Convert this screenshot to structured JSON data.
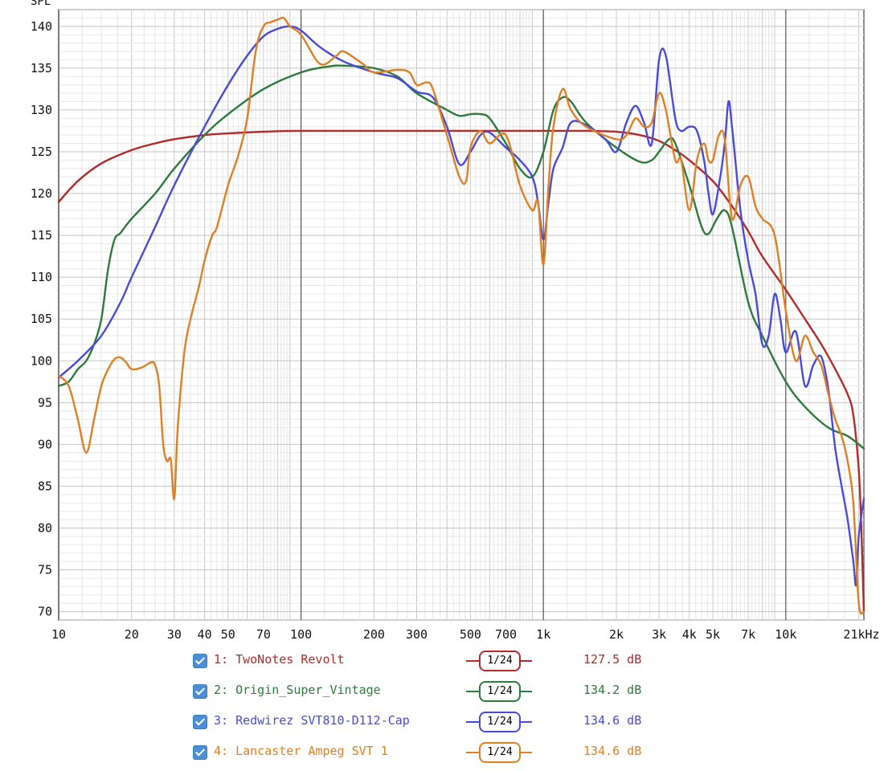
{
  "chart_data": {
    "type": "line",
    "title": "",
    "ylabel": "SPL",
    "xlabel": "",
    "xscale": "log",
    "xlim": [
      10,
      21000
    ],
    "ylim": [
      69,
      142
    ],
    "grid": true,
    "x_ticks": [
      10,
      20,
      30,
      40,
      50,
      70,
      100,
      200,
      300,
      500,
      700,
      1000,
      2000,
      3000,
      4000,
      5000,
      7000,
      10000,
      21000
    ],
    "x_tick_labels": [
      "10",
      "20",
      "30",
      "40",
      "50",
      "70",
      "100",
      "200",
      "300",
      "500",
      "700",
      "1k",
      "2k",
      "3k",
      "4k",
      "5k",
      "7k",
      "10k",
      "21kHz"
    ],
    "y_ticks": [
      70,
      75,
      80,
      85,
      90,
      95,
      100,
      105,
      110,
      115,
      120,
      125,
      130,
      135,
      140
    ],
    "y_tick_labels": [
      "70",
      "75",
      "80",
      "85",
      "90",
      "95",
      "100",
      "105",
      "110",
      "115",
      "120",
      "125",
      "130",
      "135",
      "140"
    ],
    "series": [
      {
        "name": "1: TwoNotes Revolt",
        "color": "#b22a2a",
        "smoothing": "1/24",
        "level": "127.5 dB",
        "points": [
          [
            10,
            119
          ],
          [
            12,
            121.5
          ],
          [
            15,
            123.6
          ],
          [
            20,
            125.2
          ],
          [
            25,
            126
          ],
          [
            30,
            126.5
          ],
          [
            40,
            127
          ],
          [
            50,
            127.2
          ],
          [
            70,
            127.4
          ],
          [
            100,
            127.5
          ],
          [
            300,
            127.5
          ],
          [
            1000,
            127.5
          ],
          [
            1500,
            127.5
          ],
          [
            2000,
            127.4
          ],
          [
            2500,
            127
          ],
          [
            3000,
            126.3
          ],
          [
            3500,
            125.2
          ],
          [
            4000,
            124
          ],
          [
            5000,
            121.5
          ],
          [
            6000,
            118.5
          ],
          [
            7000,
            115.5
          ],
          [
            8000,
            112.5
          ],
          [
            10000,
            108.5
          ],
          [
            12000,
            105
          ],
          [
            14000,
            102
          ],
          [
            16000,
            99
          ],
          [
            18000,
            96
          ],
          [
            19000,
            93.5
          ],
          [
            20000,
            87
          ],
          [
            20500,
            80
          ],
          [
            21000,
            70
          ]
        ]
      },
      {
        "name": "2: Origin_Super_Vintage",
        "color": "#2e7a3e",
        "smoothing": "1/24",
        "level": "134.2 dB",
        "points": [
          [
            10,
            97
          ],
          [
            11,
            97.5
          ],
          [
            12,
            99
          ],
          [
            13,
            100
          ],
          [
            14,
            102
          ],
          [
            15,
            105
          ],
          [
            16,
            111
          ],
          [
            17,
            114.5
          ],
          [
            18,
            115.3
          ],
          [
            20,
            117
          ],
          [
            25,
            120
          ],
          [
            30,
            123
          ],
          [
            40,
            127
          ],
          [
            50,
            129.5
          ],
          [
            70,
            132.5
          ],
          [
            100,
            134.5
          ],
          [
            130,
            135.2
          ],
          [
            150,
            135.3
          ],
          [
            200,
            135
          ],
          [
            250,
            134
          ],
          [
            300,
            132
          ],
          [
            400,
            130
          ],
          [
            450,
            129.3
          ],
          [
            500,
            129.5
          ],
          [
            550,
            129.5
          ],
          [
            600,
            129
          ],
          [
            700,
            126
          ],
          [
            800,
            123
          ],
          [
            900,
            122
          ],
          [
            1000,
            125
          ],
          [
            1100,
            130
          ],
          [
            1200,
            131.5
          ],
          [
            1300,
            131
          ],
          [
            1500,
            128.5
          ],
          [
            2000,
            125.5
          ],
          [
            2500,
            123.8
          ],
          [
            2800,
            124
          ],
          [
            3000,
            125
          ],
          [
            3300,
            126.5
          ],
          [
            3500,
            126
          ],
          [
            4000,
            121
          ],
          [
            4500,
            116
          ],
          [
            4800,
            115.2
          ],
          [
            5200,
            117
          ],
          [
            5600,
            118
          ],
          [
            6000,
            116
          ],
          [
            7000,
            107
          ],
          [
            8000,
            103
          ],
          [
            10000,
            97.5
          ],
          [
            12000,
            94.5
          ],
          [
            15000,
            92
          ],
          [
            18000,
            91
          ],
          [
            21000,
            89.5
          ]
        ]
      },
      {
        "name": "3: Redwirez SVT810-D112-Cap",
        "color": "#4a4ad9",
        "smoothing": "1/24",
        "level": "134.6 dB",
        "points": [
          [
            10,
            98
          ],
          [
            12,
            100
          ],
          [
            15,
            103
          ],
          [
            18,
            107
          ],
          [
            20,
            110
          ],
          [
            25,
            116
          ],
          [
            30,
            121
          ],
          [
            40,
            128
          ],
          [
            50,
            133
          ],
          [
            60,
            136.5
          ],
          [
            70,
            138.8
          ],
          [
            80,
            139.7
          ],
          [
            90,
            140
          ],
          [
            100,
            139.5
          ],
          [
            120,
            137.5
          ],
          [
            150,
            135.8
          ],
          [
            200,
            134.5
          ],
          [
            250,
            133.8
          ],
          [
            300,
            132.2
          ],
          [
            350,
            131.5
          ],
          [
            400,
            128
          ],
          [
            450,
            123.5
          ],
          [
            500,
            125
          ],
          [
            550,
            127
          ],
          [
            600,
            127.3
          ],
          [
            700,
            125.5
          ],
          [
            800,
            124
          ],
          [
            900,
            122
          ],
          [
            950,
            119
          ],
          [
            1000,
            114.5
          ],
          [
            1050,
            119
          ],
          [
            1100,
            123
          ],
          [
            1200,
            125.5
          ],
          [
            1300,
            128.5
          ],
          [
            1500,
            128.2
          ],
          [
            1800,
            126.5
          ],
          [
            2000,
            125
          ],
          [
            2200,
            128.5
          ],
          [
            2400,
            130.5
          ],
          [
            2600,
            128.5
          ],
          [
            2800,
            126
          ],
          [
            3000,
            136
          ],
          [
            3200,
            136.5
          ],
          [
            3500,
            129
          ],
          [
            3700,
            127.5
          ],
          [
            4000,
            128
          ],
          [
            4300,
            127.5
          ],
          [
            4600,
            124
          ],
          [
            4800,
            120
          ],
          [
            5000,
            117.5
          ],
          [
            5300,
            121
          ],
          [
            5600,
            126
          ],
          [
            5800,
            131
          ],
          [
            6000,
            128
          ],
          [
            6500,
            118
          ],
          [
            7000,
            112
          ],
          [
            7500,
            108
          ],
          [
            8000,
            102
          ],
          [
            8500,
            103
          ],
          [
            9000,
            108
          ],
          [
            9500,
            105
          ],
          [
            10000,
            101
          ],
          [
            11000,
            103.5
          ],
          [
            12000,
            97
          ],
          [
            13000,
            99.5
          ],
          [
            14000,
            100.5
          ],
          [
            15000,
            96.5
          ],
          [
            16000,
            89.5
          ],
          [
            17000,
            85
          ],
          [
            18000,
            81
          ],
          [
            19000,
            76
          ],
          [
            19500,
            73.2
          ],
          [
            20000,
            79
          ],
          [
            21000,
            83.5
          ]
        ]
      },
      {
        "name": "4: Lancaster Ampeg SVT 1",
        "color": "#e07f22",
        "smoothing": "1/24",
        "level": "134.6 dB",
        "points": [
          [
            10,
            98.2
          ],
          [
            11,
            97
          ],
          [
            12,
            93
          ],
          [
            13,
            89
          ],
          [
            14,
            93
          ],
          [
            15,
            97
          ],
          [
            16,
            99
          ],
          [
            17,
            100.2
          ],
          [
            18,
            100.4
          ],
          [
            19,
            99.8
          ],
          [
            20,
            99
          ],
          [
            22,
            99.2
          ],
          [
            24,
            99.8
          ],
          [
            25,
            99.5
          ],
          [
            26,
            97
          ],
          [
            27,
            90
          ],
          [
            28,
            88
          ],
          [
            29,
            88.2
          ],
          [
            30,
            83.5
          ],
          [
            31,
            92
          ],
          [
            33,
            101
          ],
          [
            35,
            105
          ],
          [
            38,
            109
          ],
          [
            40,
            112
          ],
          [
            43,
            115
          ],
          [
            45,
            116
          ],
          [
            50,
            121
          ],
          [
            55,
            124.5
          ],
          [
            60,
            129
          ],
          [
            65,
            137
          ],
          [
            70,
            140
          ],
          [
            75,
            140.5
          ],
          [
            80,
            140.8
          ],
          [
            85,
            141
          ],
          [
            90,
            140
          ],
          [
            100,
            139
          ],
          [
            120,
            135.5
          ],
          [
            140,
            136.5
          ],
          [
            150,
            137
          ],
          [
            180,
            135.5
          ],
          [
            200,
            134.5
          ],
          [
            250,
            134.8
          ],
          [
            280,
            134.5
          ],
          [
            300,
            133
          ],
          [
            330,
            133.3
          ],
          [
            350,
            132.5
          ],
          [
            400,
            127
          ],
          [
            450,
            122
          ],
          [
            480,
            121.5
          ],
          [
            500,
            125.5
          ],
          [
            550,
            127.5
          ],
          [
            600,
            126
          ],
          [
            700,
            127
          ],
          [
            800,
            121
          ],
          [
            900,
            118
          ],
          [
            950,
            119
          ],
          [
            1000,
            111.5
          ],
          [
            1050,
            121
          ],
          [
            1100,
            128
          ],
          [
            1200,
            132.5
          ],
          [
            1300,
            130
          ],
          [
            1500,
            128
          ],
          [
            2000,
            126.5
          ],
          [
            2200,
            127
          ],
          [
            2400,
            129
          ],
          [
            2600,
            128
          ],
          [
            2800,
            128.5
          ],
          [
            3000,
            132
          ],
          [
            3200,
            130
          ],
          [
            3500,
            124
          ],
          [
            3700,
            124
          ],
          [
            4000,
            118
          ],
          [
            4300,
            124
          ],
          [
            4600,
            126
          ],
          [
            4800,
            124
          ],
          [
            5000,
            124
          ],
          [
            5300,
            127
          ],
          [
            5600,
            126.5
          ],
          [
            6000,
            117
          ],
          [
            6500,
            121
          ],
          [
            7000,
            122
          ],
          [
            7500,
            118.5
          ],
          [
            8000,
            117
          ],
          [
            9000,
            115
          ],
          [
            10000,
            106
          ],
          [
            11000,
            100
          ],
          [
            12000,
            103
          ],
          [
            13000,
            101
          ],
          [
            14000,
            99.5
          ],
          [
            15000,
            96
          ],
          [
            16000,
            93
          ],
          [
            17000,
            91
          ],
          [
            18000,
            88
          ],
          [
            19000,
            83
          ],
          [
            20000,
            71
          ],
          [
            21000,
            70
          ]
        ]
      }
    ]
  }
}
